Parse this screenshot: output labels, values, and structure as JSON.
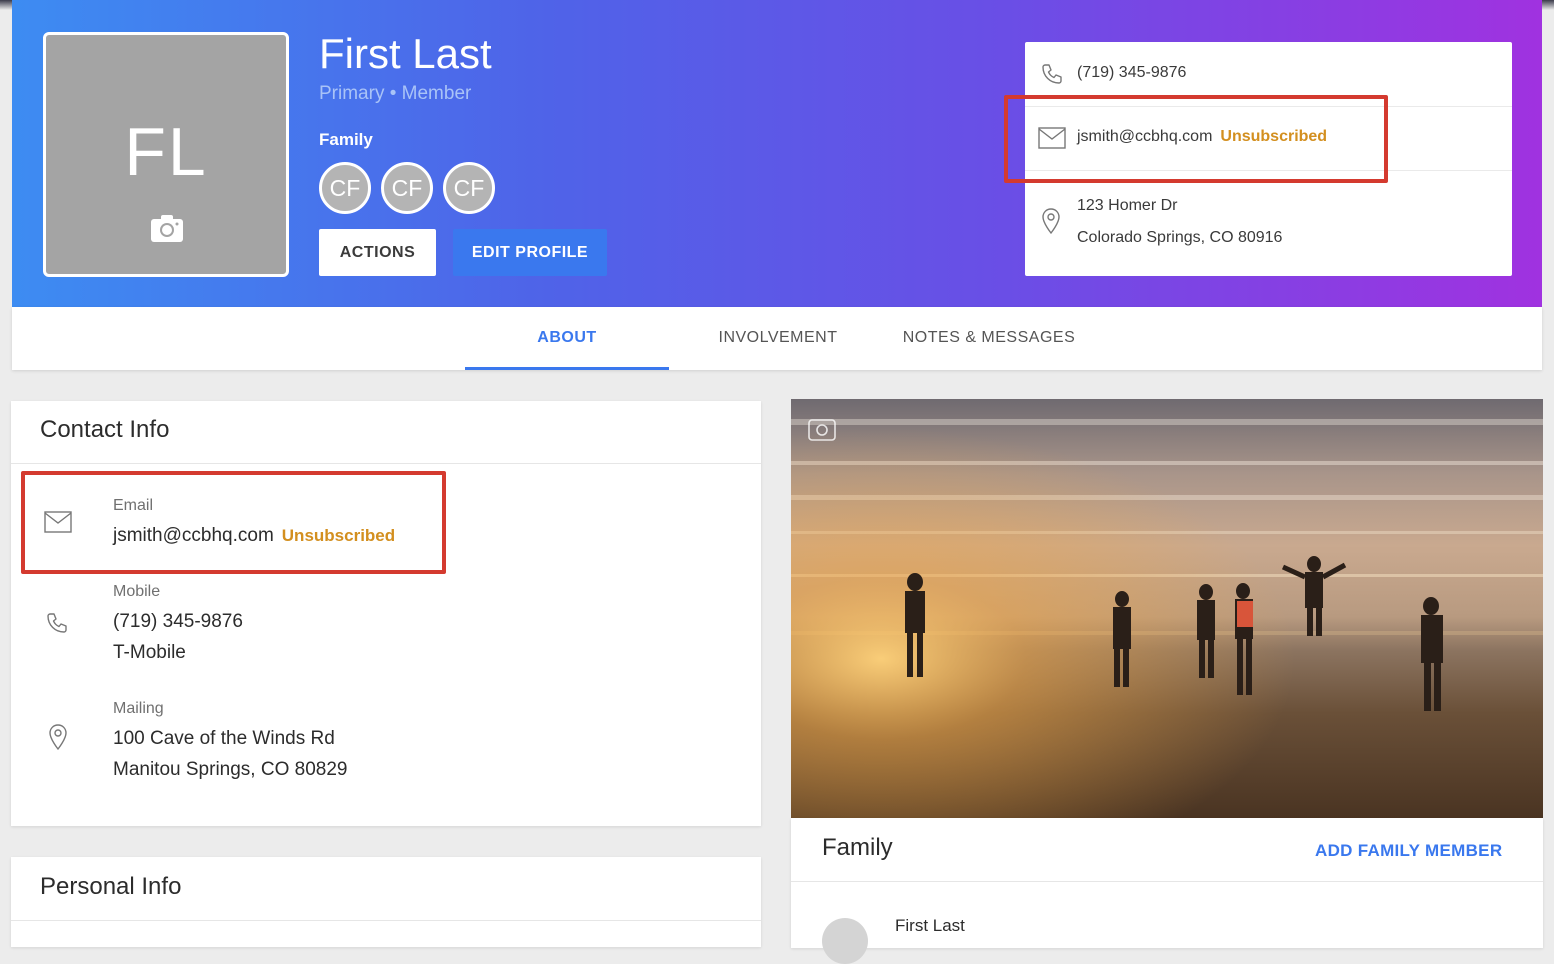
{
  "profile": {
    "initials": "FL",
    "name": "First Last",
    "subtitle": "Primary • Member",
    "family_label": "Family",
    "family_chips": [
      "CF",
      "CF",
      "CF"
    ],
    "actions_label": "ACTIONS",
    "edit_label": "EDIT PROFILE"
  },
  "header_contact": {
    "phone": "(719) 345-9876",
    "email": "jsmith@ccbhq.com",
    "email_status": "Unsubscribed",
    "address_line1": "123 Homer Dr",
    "address_line2": "Colorado Springs, CO 80916"
  },
  "tabs": [
    {
      "label": "ABOUT",
      "active": true
    },
    {
      "label": "INVOLVEMENT",
      "active": false
    },
    {
      "label": "NOTES & MESSAGES",
      "active": false
    }
  ],
  "contact_info": {
    "title": "Contact Info",
    "email_label": "Email",
    "email": "jsmith@ccbhq.com",
    "email_status": "Unsubscribed",
    "mobile_label": "Mobile",
    "mobile": "(719) 345-9876",
    "carrier": "T-Mobile",
    "mailing_label": "Mailing",
    "mailing_line1": "100 Cave of the Winds Rd",
    "mailing_line2": "Manitou Springs, CO 80829"
  },
  "personal_info": {
    "title": "Personal Info"
  },
  "family_panel": {
    "title": "Family",
    "add_label": "ADD FAMILY MEMBER",
    "member_name": "First Last"
  },
  "colors": {
    "accent": "#3a78ee",
    "unsubscribed": "#d38f1f",
    "highlight": "#d43a2f"
  }
}
